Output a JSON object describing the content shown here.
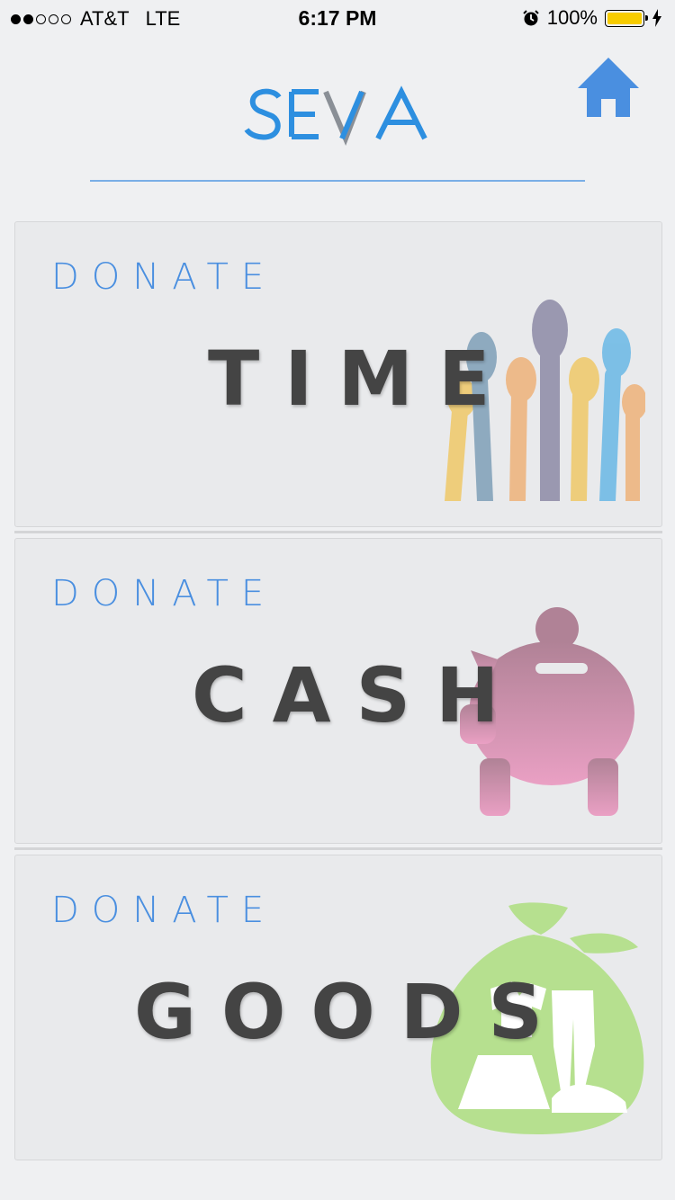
{
  "status_bar": {
    "carrier": "AT&T",
    "network": "LTE",
    "time": "6:17 PM",
    "battery_percent": "100%",
    "signal_bars_on": 2,
    "signal_bars_total": 5
  },
  "header": {
    "logo_text": "SEVA",
    "home_icon": "home-icon",
    "accent_color": "#4a8fe0"
  },
  "cards": [
    {
      "label": "DONATE",
      "title": "TIME",
      "icon": "raised-hands-icon"
    },
    {
      "label": "DONATE",
      "title": "CASH",
      "icon": "piggy-bank-icon"
    },
    {
      "label": "DONATE",
      "title": "GOODS",
      "icon": "clothes-bag-icon"
    }
  ]
}
